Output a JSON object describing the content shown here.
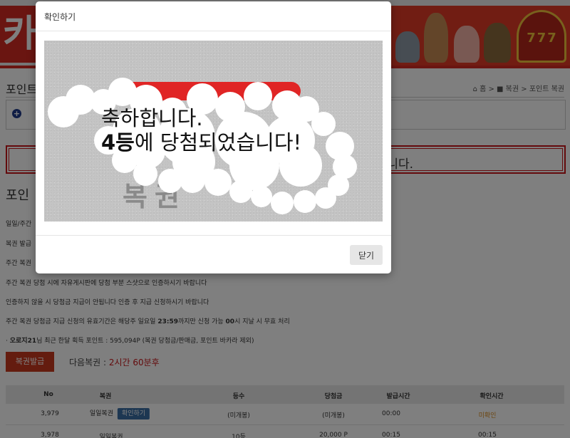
{
  "site": {
    "logo_text": "카",
    "slot_text": "777",
    "breadcrumb": "⌂ 홈 > ■ 복권 > 포인트 복권",
    "section_title": "포인트",
    "red_box_text": "니다.",
    "h2": "포인",
    "rules": [
      "일일/주간",
      "복권 발급",
      "주간 복권",
      "주간 복권 당첨 시에 자유게시판에 당첨 부분 스샷으로 인증하시기 바랍니다",
      "인증하지 않을 시 당첨금 지급이 안됩니다 인증 후 지급 신청하시기 바랍니다"
    ],
    "validity_pre": "주간 복권 당첨금 지급 신청의 유효기간은 해당주 일요일 ",
    "validity_time": "23:59",
    "validity_mid": "까지만 신청 가능 ",
    "validity_hour": "00",
    "validity_post": "시 지날 시 무효 처리",
    "points_user": "오로지21",
    "points_text": "님 최근 한달 획득 포인트 : 595,094P (복권 당첨금/판매금, 포인트 바카라 제외)",
    "issue_button": "복권발급",
    "next_label": "다음복권 : ",
    "next_time": "2시간 60분후"
  },
  "table": {
    "headers": [
      "No",
      "복권",
      "등수",
      "당첨금",
      "발급시간",
      "확인시간"
    ],
    "rows": [
      {
        "no": "3,979",
        "type": "일일복권",
        "action": "확인하기",
        "rank": "(미개봉)",
        "prize": "(미개봉)",
        "issued": "00:00",
        "checked": "미확인"
      },
      {
        "no": "3,978",
        "type": "일일복권",
        "action": "",
        "rank": "10등",
        "prize": "20,000 P",
        "issued": "00:15",
        "checked": "00:15"
      }
    ]
  },
  "modal": {
    "title": "확인하기",
    "congrats": "축하합니다.",
    "rank": "4등",
    "result": "에 당첨되었습니다!",
    "ghost_text": "복권",
    "close_button": "닫기"
  }
}
